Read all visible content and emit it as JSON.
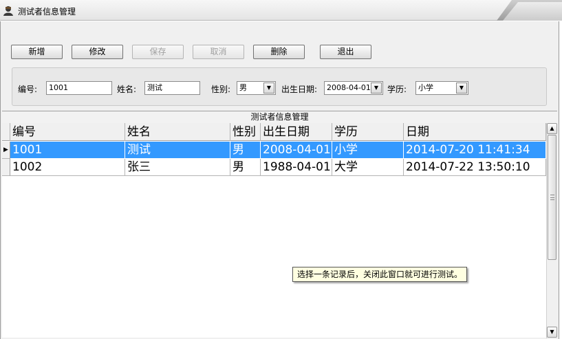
{
  "window": {
    "title": "测试者信息管理"
  },
  "toolbar": {
    "add_label": "新增",
    "edit_label": "修改",
    "save_label": "保存",
    "cancel_label": "取消",
    "delete_label": "删除",
    "exit_label": "退出"
  },
  "form": {
    "id_label": "编号:",
    "id_value": "1001",
    "name_label": "姓名:",
    "name_value": "测试",
    "gender_label": "性别:",
    "gender_value": "男",
    "birth_label": "出生日期:",
    "birth_value": "2008-04-01",
    "edu_label": "学历:",
    "edu_value": "小学"
  },
  "grid": {
    "caption": "测试者信息管理",
    "columns": [
      "编号",
      "姓名",
      "性别",
      "出生日期",
      "学历",
      "日期"
    ],
    "rows": [
      {
        "id": "1001",
        "name": "测试",
        "gender": "男",
        "birth": "2008-04-01",
        "edu": "小学",
        "date": "2014-07-20 11:41:34"
      },
      {
        "id": "1002",
        "name": "张三",
        "gender": "男",
        "birth": "1988-04-01",
        "edu": "大学",
        "date": "2014-07-22 13:50:10"
      }
    ],
    "selected_row": 0
  },
  "tooltip": {
    "text": "选择一条记录后，关闭此窗口就可进行测试。"
  },
  "icons": {
    "app": "user-avatar-icon",
    "dropdown": "chevron-down-icon",
    "row_pointer": "triangle-right-icon",
    "scroll_up": "chevron-up-icon",
    "scroll_down": "chevron-down-icon"
  },
  "colors": {
    "selection": "#3399ff",
    "tooltip_bg": "#ffffe1"
  }
}
